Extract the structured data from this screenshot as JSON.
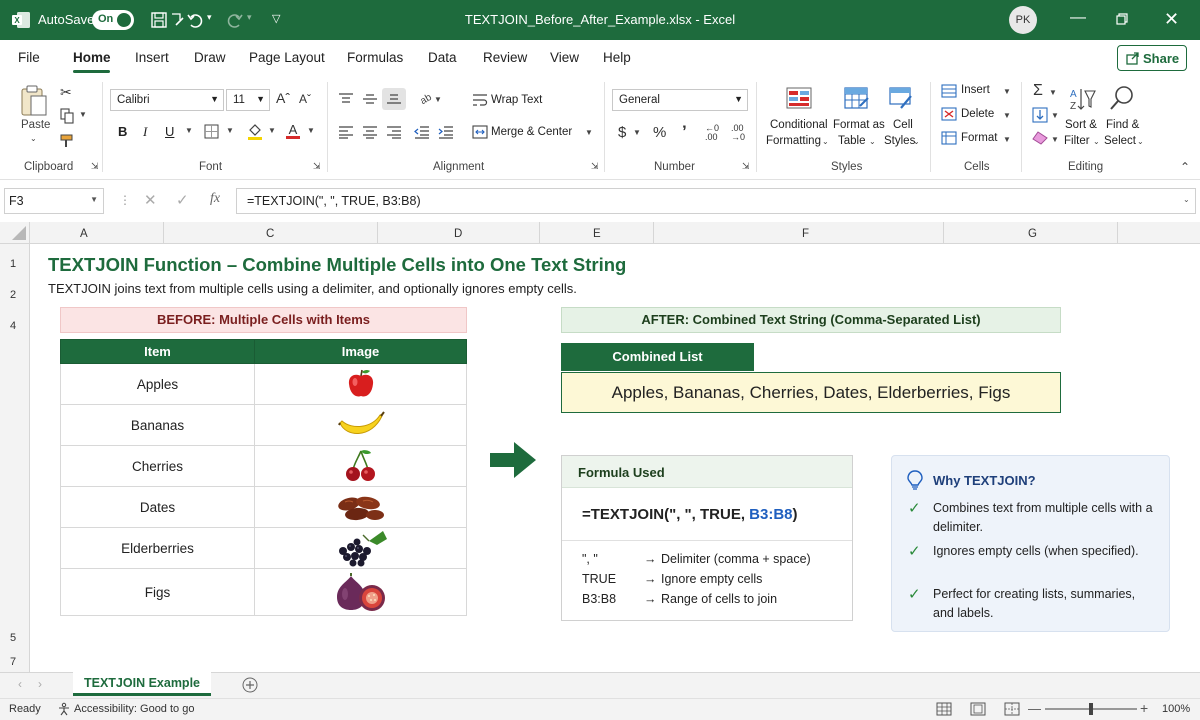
{
  "app": {
    "autosave_label": "AutoSave",
    "autosave_state": "On",
    "window_title": "TEXTJOIN_Before_After_Example.xlsx  -  Excel",
    "user_initials": "PK",
    "accent_color": "#1e6b3d"
  },
  "menu": {
    "items": [
      "File",
      "Home",
      "Insert",
      "Draw",
      "Page Layout",
      "Formulas",
      "Data",
      "Review",
      "View",
      "Help"
    ],
    "active": "Home",
    "share_label": "Share"
  },
  "ribbon": {
    "clipboard": {
      "paste_label": "Paste",
      "group_label": "Clipboard"
    },
    "font": {
      "font_name": "Calibri",
      "font_size": "11",
      "group_label": "Font",
      "bold": "B",
      "italic": "I",
      "underline": "U"
    },
    "alignment": {
      "wrap_text": "Wrap Text",
      "merge_center": "Merge & Center",
      "group_label": "Alignment"
    },
    "number": {
      "format": "General",
      "group_label": "Number"
    },
    "styles": {
      "conditional_1": "Conditional",
      "conditional_2": "Formatting",
      "format_table_1": "Format as",
      "format_table_2": "Table",
      "cell_styles_1": "Cell",
      "cell_styles_2": "Styles",
      "group_label": "Styles"
    },
    "cells": {
      "insert": "Insert",
      "delete": "Delete",
      "format": "Format",
      "group_label": "Cells"
    },
    "editing": {
      "sort_1": "Sort &",
      "sort_2": "Filter",
      "find_1": "Find &",
      "find_2": "Select",
      "group_label": "Editing"
    }
  },
  "formula_bar": {
    "name_box": "F3",
    "formula": "=TEXTJOIN(\", \", TRUE, B3:B8)"
  },
  "grid": {
    "columns": [
      "A",
      "C",
      "D",
      "E",
      "F",
      "G"
    ],
    "rows": [
      "1",
      "2",
      "4",
      "5",
      "7"
    ]
  },
  "sheet": {
    "title": "TEXTJOIN Function – Combine Multiple Cells into One Text String",
    "subtitle": "TEXTJOIN joins text from multiple cells using a delimiter, and optionally ignores empty cells.",
    "before_header": "BEFORE:  Multiple Cells with Items",
    "after_header": "AFTER:  Combined Text String (Comma-Separated List)",
    "table": {
      "col_item": "Item",
      "col_image": "Image",
      "rows": [
        {
          "item": "Apples",
          "image_icon": "apple-icon"
        },
        {
          "item": "Bananas",
          "image_icon": "banana-icon"
        },
        {
          "item": "Cherries",
          "image_icon": "cherries-icon"
        },
        {
          "item": "Dates",
          "image_icon": "dates-icon"
        },
        {
          "item": "Elderberries",
          "image_icon": "elderberries-icon"
        },
        {
          "item": "Figs",
          "image_icon": "figs-icon"
        }
      ]
    },
    "combined_label": "Combined List",
    "combined_value": "Apples, Bananas, Cherries, Dates, Elderberries, Figs",
    "formula_card": {
      "header": "Formula Used",
      "formula_prefix": "=TEXTJOIN(\", \", TRUE, ",
      "formula_range": "B3:B8",
      "formula_suffix": ")",
      "explanations": [
        {
          "arg": "\", \"",
          "desc": "Delimiter (comma + space)"
        },
        {
          "arg": "TRUE",
          "desc": "Ignore empty cells"
        },
        {
          "arg": "B3:B8",
          "desc": "Range of cells to join"
        }
      ]
    },
    "why_card": {
      "title": "Why TEXTJOIN?",
      "items": [
        "Combines text from multiple cells with a delimiter.",
        "Ignores empty cells (when specified).",
        "Perfect for creating lists, summaries, and labels."
      ]
    }
  },
  "tabs": {
    "active_sheet": "TEXTJOIN Example"
  },
  "status": {
    "ready": "Ready",
    "accessibility": "Accessibility: Good to go",
    "zoom": "100%"
  }
}
